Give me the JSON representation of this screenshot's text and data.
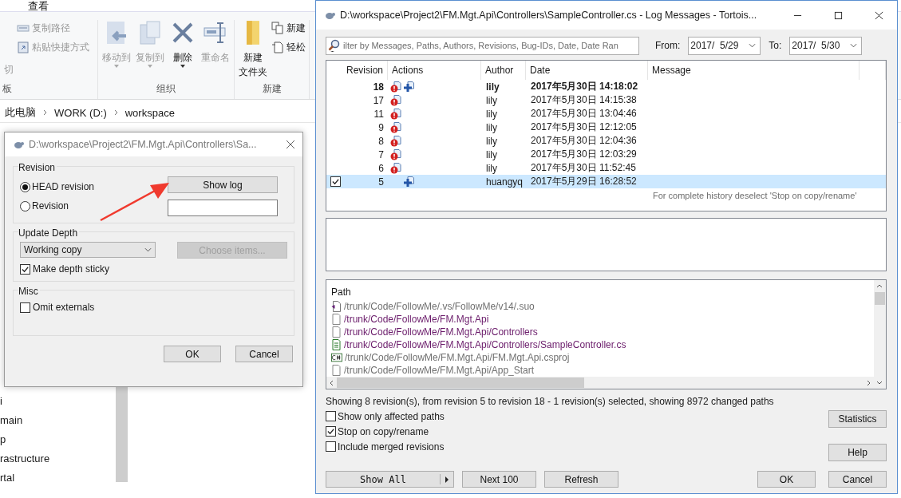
{
  "explorer": {
    "menu_tabs": [
      "查看"
    ],
    "ribbon_groups": [
      {
        "label": "板",
        "columns": [
          [
            {
              "kind": "cut",
              "label": "切",
              "disabled": true
            }
          ],
          [
            {
              "kind": "copypath",
              "label": "复制路径",
              "disabled": true
            },
            {
              "kind": "paste",
              "label": "粘贴快捷方式",
              "disabled": true
            }
          ]
        ]
      },
      {
        "label": "组织",
        "columns": [
          [
            {
              "kind": "move",
              "label_lines": [
                "移动到"
              ],
              "dropdown": true,
              "disabled": true
            }
          ],
          [
            {
              "kind": "copy",
              "label_lines": [
                "复制到"
              ],
              "dropdown": true,
              "disabled": true
            }
          ],
          [
            {
              "kind": "delete",
              "label_lines": [
                "删除"
              ],
              "dropdown": true,
              "disabled": false
            }
          ],
          [
            {
              "kind": "rename",
              "label_lines": [
                "重命名"
              ],
              "dropdown": false,
              "disabled": true
            }
          ]
        ]
      },
      {
        "label": "新建",
        "columns": [
          [
            {
              "kind": "folder",
              "label_lines": [
                "新建",
                "文件夹"
              ],
              "dropdown": false,
              "disabled": false
            }
          ],
          [
            {
              "kind": "newitem",
              "label": "新建",
              "disabled": false
            },
            {
              "kind": "access",
              "label": "轻松",
              "disabled": false
            }
          ]
        ]
      }
    ],
    "breadcrumb": [
      "此电脑",
      "WORK (D:)",
      "workspace"
    ],
    "nav_items": [
      "i",
      "main",
      "p",
      "rastructure",
      "rtal"
    ]
  },
  "update_dialog": {
    "title": "D:\\workspace\\Project2\\FM.Mgt.Api\\Controllers\\Sa...",
    "revision_group": {
      "label": "Revision",
      "options": [
        {
          "label": "HEAD revision",
          "selected": true
        },
        {
          "label": "Revision",
          "selected": false
        }
      ],
      "show_log": "Show log"
    },
    "depth_group": {
      "label": "Update Depth",
      "depth": "Working copy",
      "choose_items": {
        "label": "Choose items...",
        "disabled": true
      },
      "sticky": {
        "label": "Make depth sticky",
        "checked": true
      }
    },
    "misc_group": {
      "label": "Misc",
      "omit_externals": {
        "label": "Omit externals",
        "checked": false
      }
    },
    "buttons": [
      "OK",
      "Cancel"
    ]
  },
  "log_window": {
    "title": "D:\\workspace\\Project2\\FM.Mgt.Api\\Controllers\\SampleController.cs - Log Messages - Tortois...",
    "filter": {
      "placeholder": "ilter by Messages, Paths, Authors, Revisions, Bug-IDs, Date, Date Ran"
    },
    "from_label": "From:",
    "from": "2017/  5/29",
    "to_label": "To:",
    "to": "2017/  5/30",
    "columns": [
      "Revision",
      "Actions",
      "Author",
      "Date",
      "Message"
    ],
    "rows": [
      {
        "revision": "18",
        "modified": true,
        "added": true,
        "author": "lily",
        "date": "2017年5月30日 14:18:02",
        "bold": true,
        "selected": false
      },
      {
        "revision": "17",
        "modified": true,
        "added": false,
        "author": "lily",
        "date": "2017年5月30日 14:15:38",
        "bold": false,
        "selected": false
      },
      {
        "revision": "11",
        "modified": true,
        "added": false,
        "author": "lily",
        "date": "2017年5月30日 13:04:46",
        "bold": false,
        "selected": false
      },
      {
        "revision": "9",
        "modified": true,
        "added": false,
        "author": "lily",
        "date": "2017年5月30日 12:12:05",
        "bold": false,
        "selected": false
      },
      {
        "revision": "8",
        "modified": true,
        "added": false,
        "author": "lily",
        "date": "2017年5月30日 12:04:36",
        "bold": false,
        "selected": false
      },
      {
        "revision": "7",
        "modified": true,
        "added": false,
        "author": "lily",
        "date": "2017年5月30日 12:03:29",
        "bold": false,
        "selected": false
      },
      {
        "revision": "6",
        "modified": true,
        "added": false,
        "author": "lily",
        "date": "2017年5月30日 11:52:45",
        "bold": false,
        "selected": false
      },
      {
        "revision": "5",
        "modified": false,
        "added": true,
        "author": "huangyq",
        "date": "2017年5月29日 16:28:52",
        "bold": false,
        "selected": true
      }
    ],
    "note": "For complete history deselect 'Stop on copy/rename'",
    "path_header": "Path",
    "paths": [
      {
        "path": "/trunk/Code/FollowMe/.vs/FollowMe/v14/.suo",
        "kind": "vsfile",
        "color": "#707070"
      },
      {
        "path": "/trunk/Code/FollowMe/FM.Mgt.Api",
        "kind": "blank",
        "color": "#6a1b6a"
      },
      {
        "path": "/trunk/Code/FollowMe/FM.Mgt.Api/Controllers",
        "kind": "blank",
        "color": "#6a1b6a"
      },
      {
        "path": "/trunk/Code/FollowMe/FM.Mgt.Api/Controllers/SampleController.cs",
        "kind": "text",
        "color": "#6a1b6a"
      },
      {
        "path": "/trunk/Code/FollowMe/FM.Mgt.Api/FM.Mgt.Api.csproj",
        "kind": "csharp",
        "color": "#707070"
      },
      {
        "path": "/trunk/Code/FollowMe/FM.Mgt.Api/App_Start",
        "kind": "blank",
        "color": "#707070"
      }
    ],
    "status": "Showing 8 revision(s), from revision 5 to revision 18 - 1 revision(s) selected, showing 8972 changed paths",
    "options": [
      {
        "label": "Show only affected paths",
        "checked": false
      },
      {
        "label": "Stop on copy/rename",
        "checked": true
      },
      {
        "label": "Include merged revisions",
        "checked": false
      }
    ],
    "side_buttons": [
      "Statistics",
      "Help"
    ],
    "show_all": "Show All",
    "bottom_buttons": [
      "Next 100",
      "Refresh"
    ],
    "dialog_buttons": [
      "OK",
      "Cancel"
    ]
  }
}
